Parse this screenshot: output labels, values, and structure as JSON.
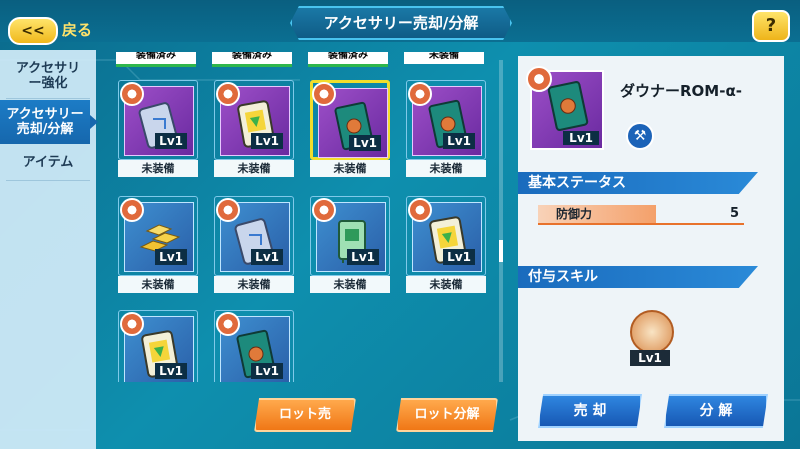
{
  "header": {
    "title": "アクセサリー売却/分解",
    "back_arrow": "<<",
    "back_label": "戻る",
    "help_label": "?"
  },
  "sidebar": {
    "items": [
      {
        "label": "アクセサリー強化",
        "active": false
      },
      {
        "label": "アクセサリー売却/分解",
        "active": true
      },
      {
        "label": "アイテム",
        "active": false
      }
    ]
  },
  "grid": {
    "top_partial_labels": [
      "装備済み",
      "装備済み",
      "装備済み",
      "未装備"
    ],
    "items": [
      {
        "level": "Lv1",
        "status": "未装備",
        "bg": "purple",
        "icon": "chip-card-icon",
        "selected": false
      },
      {
        "level": "Lv1",
        "status": "未装備",
        "bg": "purple",
        "icon": "yellow-card-icon",
        "selected": false
      },
      {
        "level": "Lv1",
        "status": "未装備",
        "bg": "purple",
        "icon": "rom-card-icon",
        "selected": true
      },
      {
        "level": "Lv1",
        "status": "未装備",
        "bg": "purple",
        "icon": "rom-card-icon",
        "selected": false
      },
      {
        "level": "Lv1",
        "status": "未装備",
        "bg": "blue",
        "icon": "gold-bars-icon",
        "selected": false
      },
      {
        "level": "Lv1",
        "status": "未装備",
        "bg": "blue",
        "icon": "chip-card-icon",
        "selected": false
      },
      {
        "level": "Lv1",
        "status": "未装備",
        "bg": "blue",
        "icon": "green-board-icon",
        "selected": false
      },
      {
        "level": "Lv1",
        "status": "未装備",
        "bg": "blue",
        "icon": "yellow-card-icon",
        "selected": false
      },
      {
        "level": "Lv1",
        "status": "",
        "bg": "blue",
        "icon": "yellow-card-icon",
        "selected": false
      },
      {
        "level": "Lv1",
        "status": "",
        "bg": "blue",
        "icon": "rom-card-icon",
        "selected": false
      }
    ]
  },
  "buttons": {
    "lot_sell": "ロット売",
    "lot_dismantle": "ロット分解",
    "sell": "売 却",
    "dismantle": "分 解"
  },
  "detail": {
    "name": "ダウナーROM-α-",
    "level": "Lv1",
    "basic_status_heading": "基本ステータス",
    "stat_label": "防御力",
    "stat_value": "5",
    "skill_heading": "付与スキル",
    "skill_level": "Lv1"
  },
  "colors": {
    "accent_orange": "#f07716",
    "accent_blue": "#1758b4",
    "selection": "#f2de2c"
  }
}
